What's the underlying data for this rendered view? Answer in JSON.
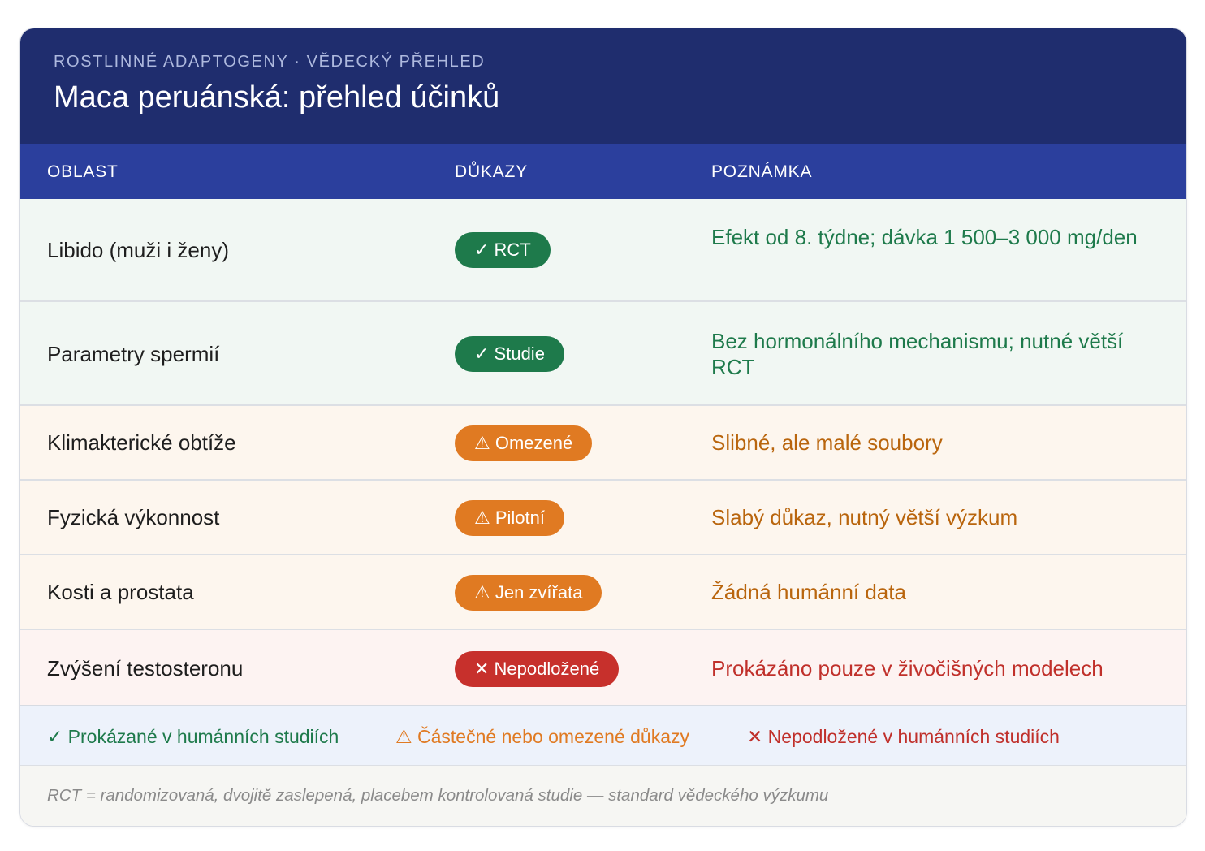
{
  "header": {
    "kicker": "ROSTLINNÉ ADAPTOGENY · VĚDECKÝ PŘEHLED",
    "title": "Maca peruánská: přehled účinků"
  },
  "columns": {
    "area": "OBLAST",
    "evidence": "DŮKAZY",
    "note": "POZNÁMKA"
  },
  "rows": [
    {
      "area": "Libido (muži i ženy)",
      "badge": "✓ RCT",
      "note": "Efekt od 8. týdne; dávka 1 500–3 000 mg/den",
      "level": "green"
    },
    {
      "area": "Parametry spermií",
      "badge": "✓ Studie",
      "note": "Bez hormonálního mechanismu; nutné větší RCT",
      "level": "green"
    },
    {
      "area": "Klimakterické obtíže",
      "badge": "⚠ Omezené",
      "note": "Slibné, ale malé soubory",
      "level": "orange"
    },
    {
      "area": "Fyzická výkonnost",
      "badge": "⚠ Pilotní",
      "note": "Slabý důkaz, nutný větší výzkum",
      "level": "orange"
    },
    {
      "area": "Kosti a prostata",
      "badge": "⚠ Jen zvířata",
      "note": "Žádná humánní data",
      "level": "orange"
    },
    {
      "area": "Zvýšení testosteronu",
      "badge": "✕ Nepodložené",
      "note": "Prokázáno pouze v živočišných modelech",
      "level": "red"
    }
  ],
  "legend": {
    "proven": "✓ Prokázané v humánních studiích",
    "partial": "⚠ Částečné nebo omezené důkazy",
    "unsupported": "✕ Nepodložené v humánních studiích"
  },
  "footnote": "RCT = randomizovaná, dvojitě zaslepená, placebem kontrolovaná studie — standard vědeckého výzkumu",
  "colors": {
    "header_bg": "#1f2d6e",
    "table_head_bg": "#2b3f9d",
    "green": "#1e7a4b",
    "orange": "#e07a22",
    "red": "#c7302c"
  }
}
